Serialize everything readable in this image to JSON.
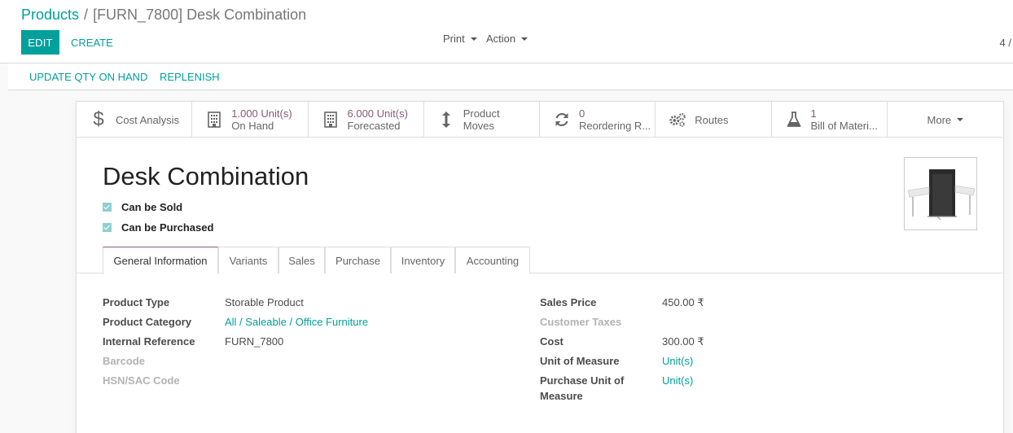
{
  "breadcrumb": {
    "parent": "Products",
    "separator": "/",
    "current": "[FURN_7800] Desk Combination"
  },
  "toolbar": {
    "edit_label": "EDIT",
    "create_label": "CREATE",
    "print_label": "Print",
    "action_label": "Action",
    "pager_text": "4 /"
  },
  "header_buttons": {
    "update_qty": "UPDATE QTY ON HAND",
    "replenish": "REPLENISH"
  },
  "smart_buttons": {
    "cost_analysis": "Cost Analysis",
    "on_hand_value": "1.000 Unit(s)",
    "on_hand_label": "On Hand",
    "forecasted_value": "6.000 Unit(s)",
    "forecasted_label": "Forecasted",
    "product_moves_1": "Product",
    "product_moves_2": "Moves",
    "reordering_value": "0",
    "reordering_label": "Reordering R...",
    "routes": "Routes",
    "bom_value": "1",
    "bom_label": "Bill of Materi...",
    "more": "More"
  },
  "product": {
    "name": "Desk Combination",
    "can_be_sold": "Can be Sold",
    "can_be_purchased": "Can be Purchased"
  },
  "tabs": [
    "General Information",
    "Variants",
    "Sales",
    "Purchase",
    "Inventory",
    "Accounting"
  ],
  "general": {
    "left": [
      {
        "label": "Product Type",
        "value": "Storable Product"
      },
      {
        "label": "Product Category",
        "value": "All / Saleable / Office Furniture"
      },
      {
        "label": "Internal Reference",
        "value": "FURN_7800"
      },
      {
        "label": "Barcode",
        "value": ""
      },
      {
        "label": "HSN/SAC Code",
        "value": ""
      }
    ],
    "right": [
      {
        "label": "Sales Price",
        "value": "450.00 ₹"
      },
      {
        "label": "Customer Taxes",
        "value": ""
      },
      {
        "label": "Cost",
        "value": "300.00 ₹"
      },
      {
        "label": "Unit of Measure",
        "value": "Unit(s)"
      },
      {
        "label_1": "Purchase Unit of",
        "label_2": "Measure",
        "value": "Unit(s)"
      }
    ]
  },
  "colors": {
    "primary": "#00A09D",
    "accent": "#875A7B"
  }
}
